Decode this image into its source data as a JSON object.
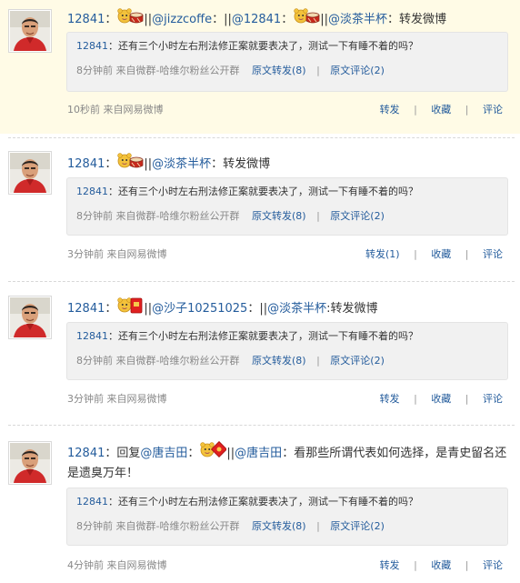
{
  "posts": [
    {
      "user": "12841",
      "segments": [
        {
          "type": "text",
          "text": "："
        },
        {
          "type": "emoticon",
          "name": "bear-drum-emoticon"
        },
        {
          "type": "text",
          "text": "||"
        },
        {
          "type": "mention",
          "text": "@jizzcoffe"
        },
        {
          "type": "text",
          "text": "：||"
        },
        {
          "type": "mention",
          "text": "@12841"
        },
        {
          "type": "text",
          "text": "："
        },
        {
          "type": "emoticon",
          "name": "bear-drum-emoticon"
        },
        {
          "type": "text",
          "text": "||"
        },
        {
          "type": "mention",
          "text": "@淡茶半杯"
        },
        {
          "type": "text",
          "text": "：转发微博"
        }
      ],
      "quote": {
        "user": "12841",
        "text": "：还有三个小时左右刑法修正案就要表决了，测试一下有睡不着的吗？",
        "meta": "8分钟前 来自微群-哈维尔粉丝公开群",
        "forward": "原文转发(8)",
        "comment": "原文评论(2)"
      },
      "footer": {
        "time_source": "10秒前 来自网易微博",
        "forward": "转发",
        "favorite": "收藏",
        "comment": "评论"
      }
    },
    {
      "user": "12841",
      "segments": [
        {
          "type": "text",
          "text": "："
        },
        {
          "type": "emoticon",
          "name": "bear-drum-emoticon"
        },
        {
          "type": "text",
          "text": "||"
        },
        {
          "type": "mention",
          "text": "@淡茶半杯"
        },
        {
          "type": "text",
          "text": "：转发微博"
        }
      ],
      "quote": {
        "user": "12841",
        "text": "：还有三个小时左右刑法修正案就要表决了，测试一下有睡不着的吗？",
        "meta": "8分钟前 来自微群-哈维尔粉丝公开群",
        "forward": "原文转发(8)",
        "comment": "原文评论(2)"
      },
      "footer": {
        "time_source": "3分钟前 来自网易微博",
        "forward": "转发(1)",
        "favorite": "收藏",
        "comment": "评论"
      }
    },
    {
      "user": "12841",
      "segments": [
        {
          "type": "text",
          "text": "："
        },
        {
          "type": "emoticon",
          "name": "bear-envelope-emoticon"
        },
        {
          "type": "text",
          "text": "||"
        },
        {
          "type": "mention",
          "text": "@沙子10251025"
        },
        {
          "type": "text",
          "text": "：||"
        },
        {
          "type": "mention",
          "text": "@淡茶半杯"
        },
        {
          "type": "text",
          "text": ":转发微博"
        }
      ],
      "quote": {
        "user": "12841",
        "text": "：还有三个小时左右刑法修正案就要表决了，测试一下有睡不着的吗？",
        "meta": "8分钟前 来自微群-哈维尔粉丝公开群",
        "forward": "原文转发(8)",
        "comment": "原文评论(2)"
      },
      "footer": {
        "time_source": "3分钟前 来自网易微博",
        "forward": "转发",
        "favorite": "收藏",
        "comment": "评论"
      }
    },
    {
      "user": "12841",
      "segments": [
        {
          "type": "text",
          "text": "：回复"
        },
        {
          "type": "mention",
          "text": "@唐吉田"
        },
        {
          "type": "text",
          "text": "："
        },
        {
          "type": "emoticon",
          "name": "bear-red-packet-emoticon"
        },
        {
          "type": "text",
          "text": "||"
        },
        {
          "type": "mention",
          "text": "@唐吉田"
        },
        {
          "type": "text",
          "text": "：看那些所谓代表如何选择，是青史留名还是遗臭万年！"
        }
      ],
      "quote": {
        "user": "12841",
        "text": "：还有三个小时左右刑法修正案就要表决了，测试一下有睡不着的吗？",
        "meta": "8分钟前 来自微群-哈维尔粉丝公开群",
        "forward": "原文转发(8)",
        "comment": "原文评论(2)"
      },
      "footer": {
        "time_source": "4分钟前 来自网易微博",
        "forward": "转发",
        "favorite": "收藏",
        "comment": "评论"
      }
    }
  ]
}
